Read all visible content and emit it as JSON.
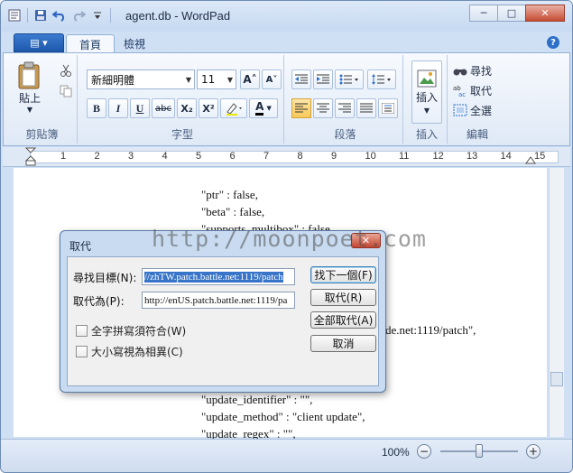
{
  "window": {
    "title": "agent.db - WordPad",
    "minimize": "─",
    "maximize": "□",
    "close": "✕"
  },
  "tabs": {
    "app_menu": "▤ ▾",
    "home": "首頁",
    "view": "檢視",
    "help": "?"
  },
  "clipboard": {
    "paste": "貼上",
    "label": "剪貼簿"
  },
  "font": {
    "family": "新細明體",
    "size": "11",
    "grow": "A˄",
    "shrink": "A˅",
    "bold": "B",
    "italic": "I",
    "underline": "U",
    "strike": "abc",
    "subscript": "X₂",
    "superscript": "X²",
    "font_color": "A",
    "label": "字型"
  },
  "paragraph": {
    "label": "段落"
  },
  "insert": {
    "label": "插入"
  },
  "editing": {
    "find": "尋找",
    "replace": "取代",
    "select_all": "全選",
    "label": "編輯"
  },
  "ruler": {
    "numbers": [
      "1",
      "2",
      "3",
      "4",
      "5",
      "6",
      "7",
      "8",
      "9",
      "10",
      "11",
      "12",
      "13",
      "14",
      "15"
    ]
  },
  "document": {
    "lines": [
      "\"ptr\" : false,",
      "\"beta\" : false,",
      "\"supports_multibox\" : false,",
      "de.net:1119/patch\",",
      "\"update_identifier\" : \"\",",
      "\"update_method\" : \"client update\",",
      "\"update_regex\" : \"\","
    ]
  },
  "status": {
    "zoom": "100%",
    "zoom_out": "−",
    "zoom_in": "+",
    "zoom_level": 0.5
  },
  "dialog": {
    "title": "取代",
    "close": "✕",
    "find_label": "尋找目標(N):",
    "find_value": "//zhTW.patch.battle.net:1119/patch",
    "replace_label": "取代為(P):",
    "replace_value": "http://enUS.patch.battle.net:1119/pa",
    "match_word": "全字拼寫須符合(W)",
    "match_case": "大小寫視為相異(C)",
    "find_next": "找下一個(F)",
    "replace": "取代(R)",
    "replace_all": "全部取代(A)",
    "cancel": "取消"
  },
  "watermark": "http://moonpoet.com"
}
